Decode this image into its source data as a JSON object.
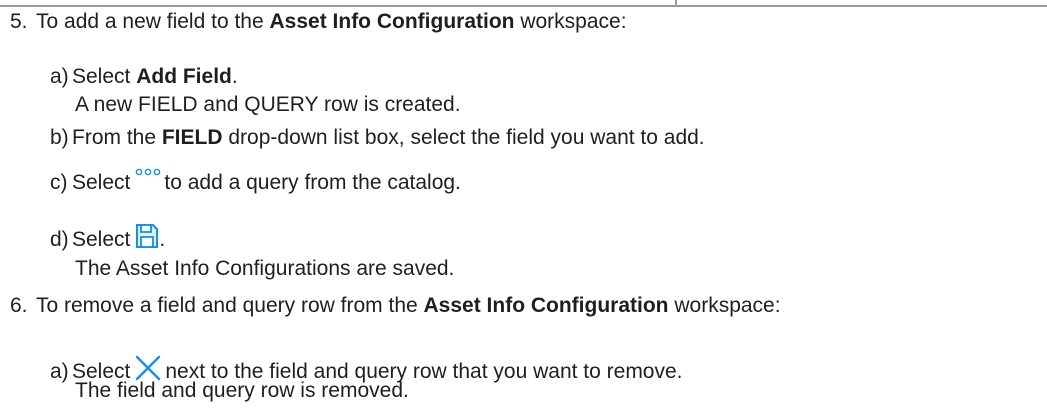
{
  "step5": {
    "number": "5.",
    "intro_pre": "To add a new field to the ",
    "intro_bold": "Asset Info Configuration",
    "intro_post": " workspace:",
    "a": {
      "letter": "a)",
      "pre": "Select ",
      "bold": "Add Field",
      "post": ".",
      "result": "A new FIELD and QUERY row is created."
    },
    "b": {
      "letter": "b)",
      "pre": "From the ",
      "bold": "FIELD",
      "post": " drop-down list box, select the field you want to add."
    },
    "c": {
      "letter": "c)",
      "pre": "Select",
      "icon": "ellipsis-dots-icon",
      "post": "to add a query from the catalog."
    },
    "d": {
      "letter": "d)",
      "pre": "Select",
      "icon": "save-icon",
      "post": ".",
      "result": "The Asset Info Configurations are saved."
    }
  },
  "step6": {
    "number": "6.",
    "intro_pre": "To remove a field and query row from the ",
    "intro_bold": "Asset Info Configuration",
    "intro_post": " workspace:",
    "a": {
      "letter": "a)",
      "pre": "Select",
      "icon": "close-x-icon",
      "post": "next to the field and query row that you want to remove.",
      "result": "The field and query row is removed."
    }
  },
  "colors": {
    "text": "#1f1f1f",
    "icon_blue": "#1a8fe3",
    "frame_gray": "#9a9a9a"
  }
}
